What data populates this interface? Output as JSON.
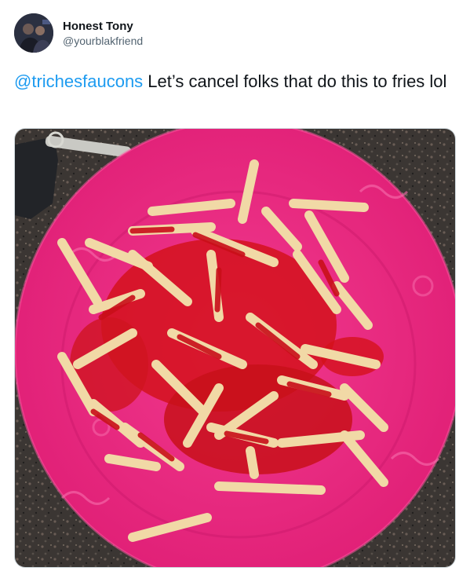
{
  "tweet": {
    "author": {
      "display_name": "Honest Tony",
      "handle": "@yourblakfriend",
      "avatar_icon": "profile-photo"
    },
    "text": {
      "mention": "@trichesfaucons",
      "body": " Let’s cancel folks that do this to fries lol"
    },
    "media": {
      "type": "photo",
      "description_icon": "photo-fries-with-ketchup-on-pink-plate"
    }
  },
  "colors": {
    "mention": "#1d9bf0",
    "text": "#0f1419",
    "secondary_text": "#536471",
    "plate": "#e8237a",
    "counter": "#3b3633"
  }
}
